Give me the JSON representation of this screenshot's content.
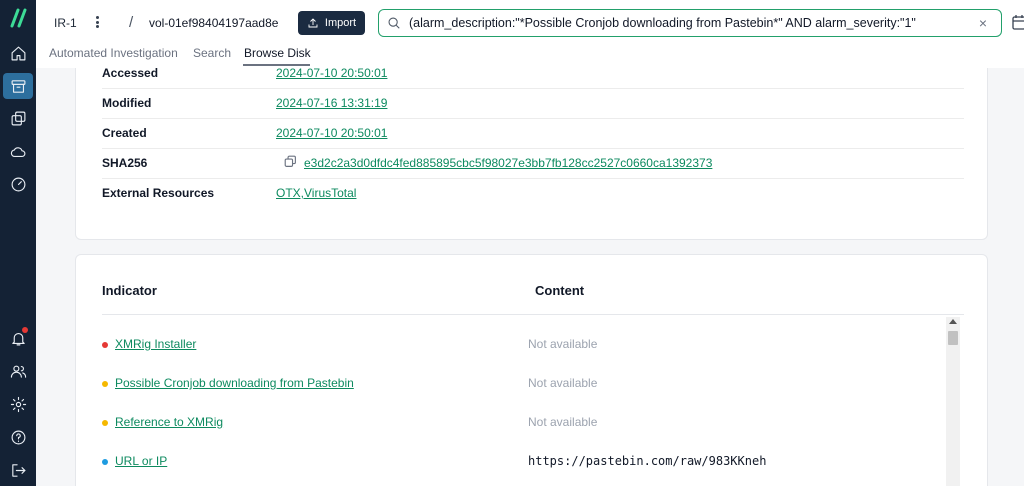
{
  "header": {
    "workspace": "IR-1",
    "separator": "/",
    "volume": "vol-01ef98404197aad8e",
    "import_label": "Import",
    "search_query": "(alarm_description:\"*Possible Cronjob downloading from Pastebin*\" AND alarm_severity:\"1\"",
    "clear_symbol": "×"
  },
  "tabs": [
    {
      "label": "Automated Investigation",
      "active": false
    },
    {
      "label": "Search",
      "active": false
    },
    {
      "label": "Browse Disk",
      "active": true
    }
  ],
  "sidebar": {
    "items": [
      {
        "icon": "home-icon"
      },
      {
        "icon": "archive-icon",
        "active": true
      },
      {
        "icon": "copy-stack-icon"
      },
      {
        "icon": "cloud-icon"
      },
      {
        "icon": "gauge-icon"
      },
      {
        "icon": "bell-icon",
        "notification": true
      },
      {
        "icon": "users-icon"
      },
      {
        "icon": "gear-icon"
      },
      {
        "icon": "help-icon"
      },
      {
        "icon": "logout-icon"
      }
    ]
  },
  "file_details": {
    "rows": [
      {
        "label": "Accessed",
        "value": "2024-07-10 20:50:01"
      },
      {
        "label": "Modified",
        "value": "2024-07-16 13:31:19"
      },
      {
        "label": "Created",
        "value": "2024-07-10 20:50:01"
      },
      {
        "label": "SHA256",
        "value": "e3d2c2a3d0dfdc4fed885895cbc5f98027e3bb7fb128cc2527c0660ca1392373"
      },
      {
        "label": "External Resources",
        "value": "OTX,VirusTotal"
      }
    ]
  },
  "indicators": {
    "headers": {
      "indicator": "Indicator",
      "content": "Content"
    },
    "rows": [
      {
        "name": "XMRig Installer",
        "severity_color": "#e53935",
        "content": "Not available"
      },
      {
        "name": "Possible Cronjob downloading from Pastebin",
        "severity_color": "#f5b800",
        "content": "Not available"
      },
      {
        "name": "Reference to XMRig",
        "severity_color": "#f5b800",
        "content": "Not available"
      },
      {
        "name": "URL or IP",
        "severity_color": "#1e9be0",
        "content": "https://pastebin.com/raw/983KKneh"
      }
    ]
  }
}
